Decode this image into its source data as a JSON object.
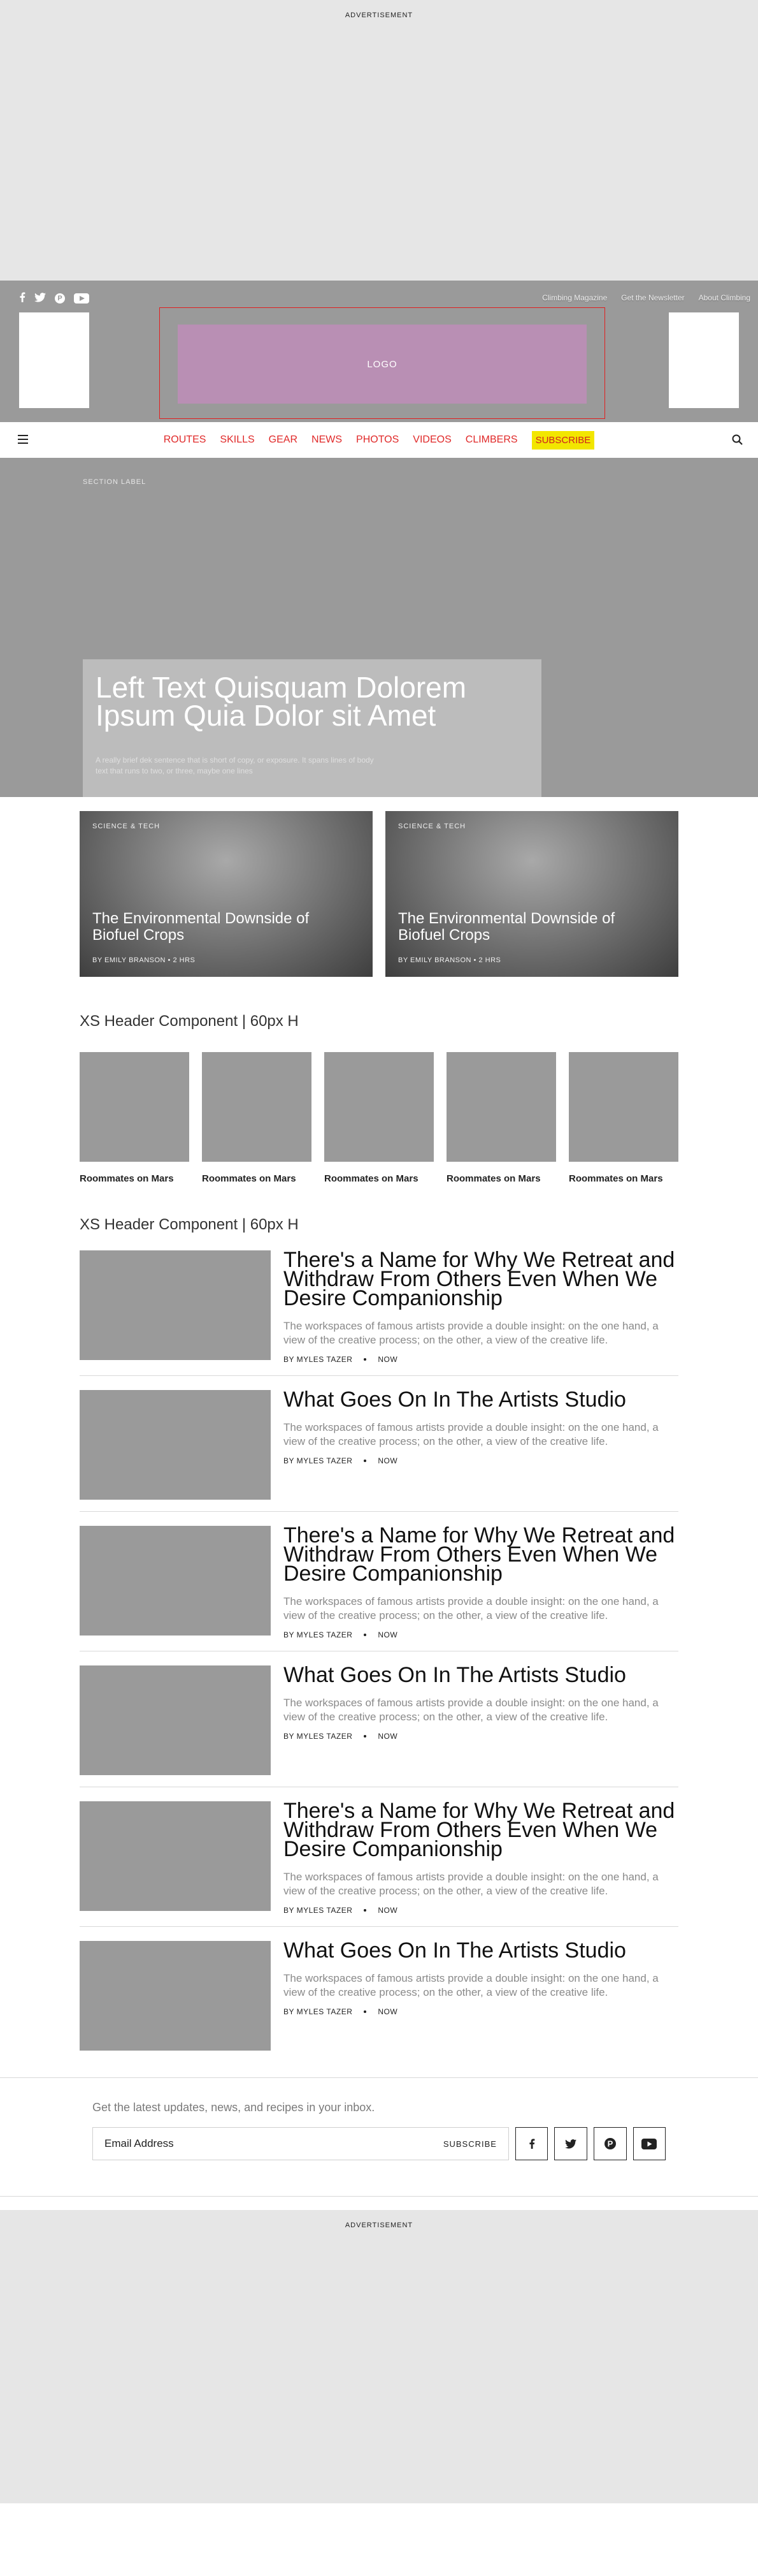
{
  "ads": {
    "top_label": "ADVERTISEMENT",
    "bottom_label": "ADVERTISEMENT"
  },
  "masthead": {
    "social": [
      "facebook-icon",
      "twitter-icon",
      "pinterest-icon",
      "youtube-icon"
    ],
    "links": [
      "Climbing Magazine",
      "Get the Newsletter",
      "About Climbing"
    ],
    "logo_text": "LOGO",
    "logo_color": "#b98fb4"
  },
  "nav": {
    "items": [
      "ROUTES",
      "SKILLS",
      "GEAR",
      "NEWS",
      "PHOTOS",
      "VIDEOS",
      "CLIMBERS"
    ],
    "subscribe": "SUBSCRIBE",
    "accent": "#e02828",
    "subscribe_bg": "#f2e600"
  },
  "hero": {
    "section_label": "SECTION LABEL",
    "title": "Left Text Quisquam Dolorem Ipsum Quia Dolor sit Amet",
    "dek": "A really brief dek sentence that is short of copy, or exposure. It spans lines of body text that runs to two, or three, maybe one lines"
  },
  "features": [
    {
      "category": "SCIENCE & TECH",
      "title": "The Environmental Downside of Biofuel Crops",
      "byline": "BY EMILY BRANSON • 2 HRS"
    },
    {
      "category": "SCIENCE & TECH",
      "title": "The Environmental Downside of Biofuel Crops",
      "byline": "BY EMILY BRANSON • 2 HRS"
    }
  ],
  "grid_section": {
    "header": "XS Header Component | 60px H",
    "tiles": [
      "Roommates on Mars",
      "Roommates on Mars",
      "Roommates on Mars",
      "Roommates on Mars",
      "Roommates on Mars"
    ]
  },
  "list_section": {
    "header": "XS Header Component | 60px H",
    "articles": [
      {
        "title": "There's a Name for Why We Retreat and Withdraw From Others Even When We Desire Companionship",
        "dek": "The workspaces of famous artists provide a double insight: on the one hand, a view of the creative process; on the other, a view of the creative life.",
        "author": "BY MYLES TAZER",
        "time": "NOW"
      },
      {
        "title": "What Goes On In The Artists Studio",
        "dek": "The workspaces of famous artists provide a double insight: on the one hand, a view of the creative process; on the other, a view of the creative life.",
        "author": "BY MYLES TAZER",
        "time": "NOW"
      },
      {
        "title": "There's a Name for Why We Retreat and Withdraw From Others Even When We Desire Companionship",
        "dek": "The workspaces of famous artists provide a double insight: on the one hand, a view of the creative process; on the other, a view of the creative life.",
        "author": "BY MYLES TAZER",
        "time": "NOW"
      },
      {
        "title": "What Goes On In The Artists Studio",
        "dek": "The workspaces of famous artists provide a double insight: on the one hand, a view of the creative process; on the other, a view of the creative life.",
        "author": "BY MYLES TAZER",
        "time": "NOW"
      },
      {
        "title": "There's a Name for Why We Retreat and Withdraw From Others Even When We Desire Companionship",
        "dek": "The workspaces of famous artists provide a double insight: on the one hand, a view of the creative process; on the other, a view of the creative life.",
        "author": "BY MYLES TAZER",
        "time": "NOW"
      },
      {
        "title": "What Goes On In The Artists Studio",
        "dek": "The workspaces of famous artists provide a double insight: on the one hand, a view of the creative process; on the other, a view of the creative life.",
        "author": "BY MYLES TAZER",
        "time": "NOW"
      }
    ]
  },
  "newsletter": {
    "text": "Get the latest updates, news, and recipes in your inbox.",
    "placeholder": "Email Address",
    "subscribe": "SUBSCRIBE",
    "social": [
      "facebook-icon",
      "twitter-icon",
      "pinterest-icon",
      "youtube-icon"
    ]
  }
}
